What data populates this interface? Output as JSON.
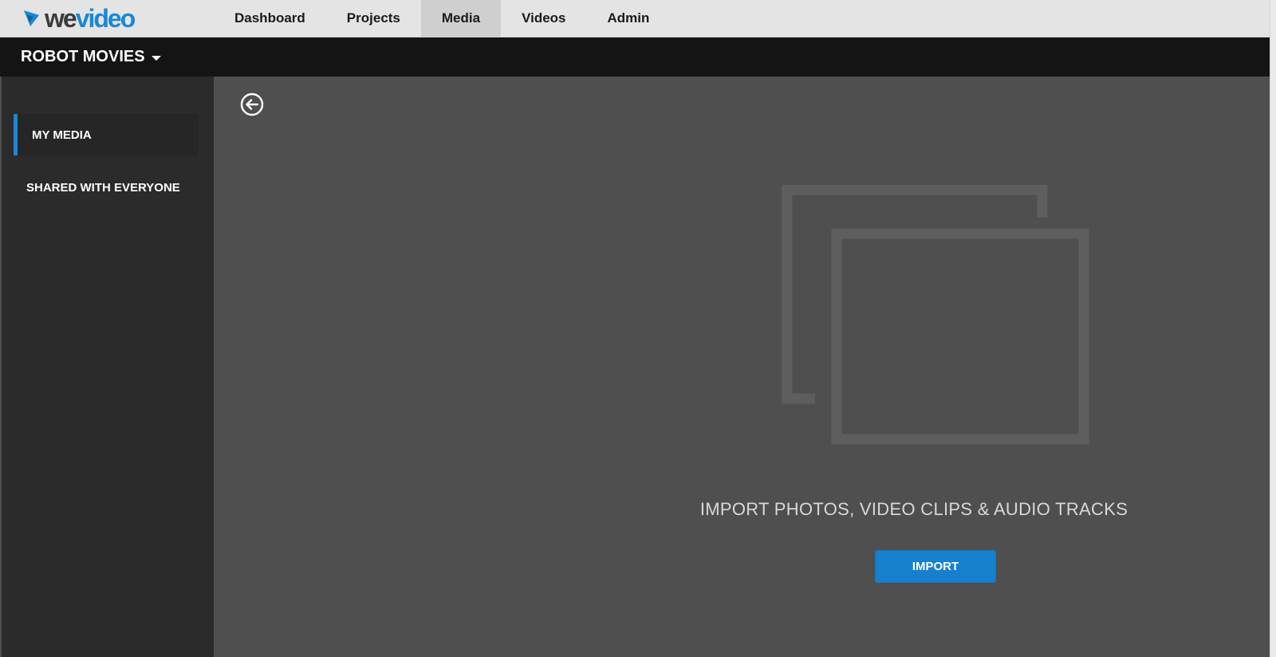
{
  "logo": {
    "prefix": "we",
    "suffix": "video",
    "icon": "wevideo-logo-icon"
  },
  "nav": {
    "items": [
      {
        "label": "Dashboard"
      },
      {
        "label": "Projects"
      },
      {
        "label": "Media",
        "active": true
      },
      {
        "label": "Videos"
      },
      {
        "label": "Admin"
      }
    ]
  },
  "project": {
    "title": "ROBOT MOVIES",
    "icon": "chevron-down-icon"
  },
  "sidebar": {
    "items": [
      {
        "label": "MY MEDIA",
        "active": true
      },
      {
        "label": "SHARED WITH EVERYONE"
      }
    ]
  },
  "main": {
    "back_icon": "back-arrow-icon",
    "empty_message": "IMPORT PHOTOS, VIDEO CLIPS & AUDIO TRACKS",
    "import_label": "IMPORT",
    "placeholder_icon": "media-stack-icon"
  },
  "colors": {
    "accent": "#1b87d4",
    "button": "#1680cf",
    "topbar": "#e4e4e4",
    "projectbar": "#141414",
    "sidebar": "#2b2b2b",
    "main": "#4f4f4f"
  }
}
